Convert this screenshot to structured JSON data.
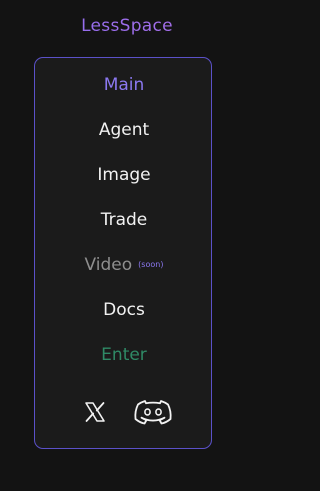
{
  "brand": {
    "name": "LessSpace"
  },
  "nav": {
    "main": "Main",
    "agent": "Agent",
    "image": "Image",
    "trade": "Trade",
    "video": "Video",
    "video_badge": "(soon)",
    "docs": "Docs",
    "enter": "Enter"
  },
  "social": {
    "icons": [
      "x-icon",
      "discord-icon"
    ]
  },
  "colors": {
    "accent": "#8b78f0",
    "border": "#5b51c9",
    "enter": "#2f8a66",
    "disabled": "#8e8e8e",
    "background": "#131313",
    "card": "#1b1b1b"
  }
}
